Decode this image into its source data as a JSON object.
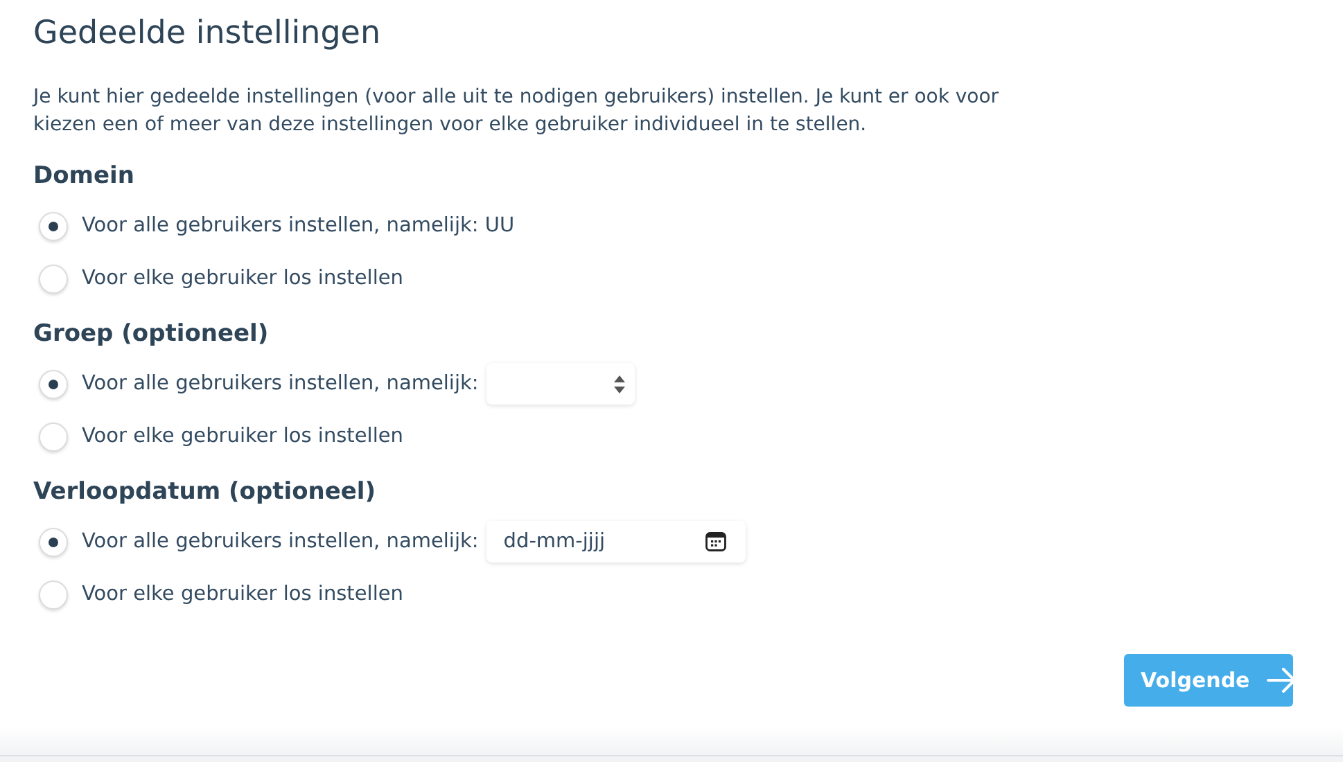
{
  "title": "Gedeelde instellingen",
  "intro": "Je kunt hier gedeelde instellingen (voor alle uit te nodigen gebruikers) instellen. Je kunt er ook voor kiezen een of meer van deze instellingen voor elke gebruiker individueel in te stellen.",
  "sections": [
    {
      "heading": "Domein",
      "options": [
        {
          "kind": "plain",
          "label": "Voor alle gebruikers instellen, namelijk: UU",
          "selected": true
        },
        {
          "kind": "plain",
          "label": "Voor elke gebruiker los instellen",
          "selected": false
        }
      ]
    },
    {
      "heading": "Groep (optioneel)",
      "options": [
        {
          "kind": "select",
          "label": "Voor alle gebruikers instellen, namelijk:",
          "selected": true
        },
        {
          "kind": "plain",
          "label": "Voor elke gebruiker los instellen",
          "selected": false
        }
      ]
    },
    {
      "heading": "Verloopdatum (optioneel)",
      "options": [
        {
          "kind": "date",
          "label": "Voor alle gebruikers instellen, namelijk:",
          "placeholder": "dd-mm-jjjj",
          "selected": true
        },
        {
          "kind": "plain",
          "label": "Voor elke gebruiker los instellen",
          "selected": false
        }
      ]
    }
  ],
  "next_button": "Volgende"
}
